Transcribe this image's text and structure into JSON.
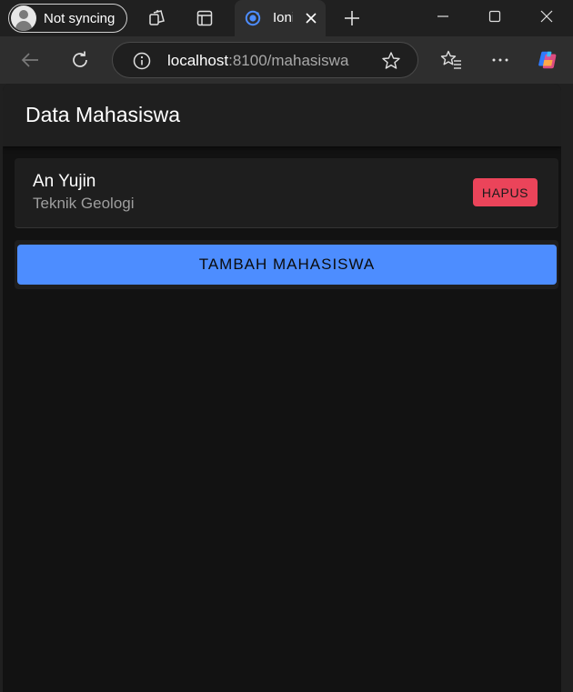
{
  "browser": {
    "profile_label": "Not syncing",
    "active_tab_title": "Ionic App",
    "url_host": "localhost",
    "url_rest": ":8100/mahasiswa"
  },
  "app": {
    "title": "Data Mahasiswa",
    "students": [
      {
        "name": "An Yujin",
        "department": "Teknik Geologi",
        "delete_label": "HAPUS"
      }
    ],
    "add_button_label": "TAMBAH MAHASISWA"
  },
  "colors": {
    "primary": "#4d8dff",
    "danger": "#eb445a",
    "page_background": "#121212",
    "header_background": "#1f1f1f"
  }
}
